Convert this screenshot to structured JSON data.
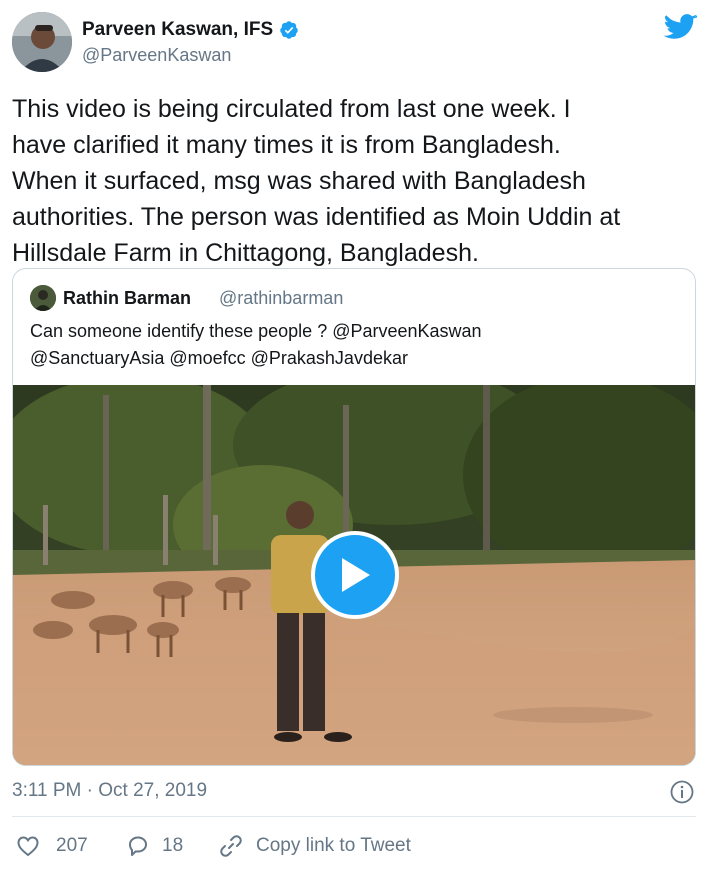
{
  "author": {
    "name": "Parveen Kaswan, IFS",
    "handle": "@ParveenKaswan",
    "verified": true
  },
  "tweet": {
    "text": "This video is being circulated from last one week. I\nhave clarified it many times it is from Bangladesh.\nWhen it surfaced, msg was shared with Bangladesh\nauthorities. The person was identified as Moin Uddin at\nHillsdale Farm in Chittagong, Bangladesh."
  },
  "quoted": {
    "name": "Rathin Barman",
    "handle": "@rathinbarman",
    "text": "Can someone identify these people ? @ParveenKaswan\n@SanctuaryAsia @moefcc @PrakashJavdekar"
  },
  "meta": {
    "timestamp": "3:11 PM · Oct 27, 2019"
  },
  "actions": {
    "likes": "207",
    "replies": "18",
    "copy_link": "Copy link to Tweet"
  },
  "colors": {
    "brand": "#1da1f2",
    "text": "#14171a",
    "muted": "#657786",
    "border": "#ccd6dd"
  },
  "icons": [
    "verified-badge-icon",
    "twitter-bird-icon",
    "play-icon",
    "info-icon",
    "heart-icon",
    "reply-bubble-icon",
    "link-icon"
  ]
}
